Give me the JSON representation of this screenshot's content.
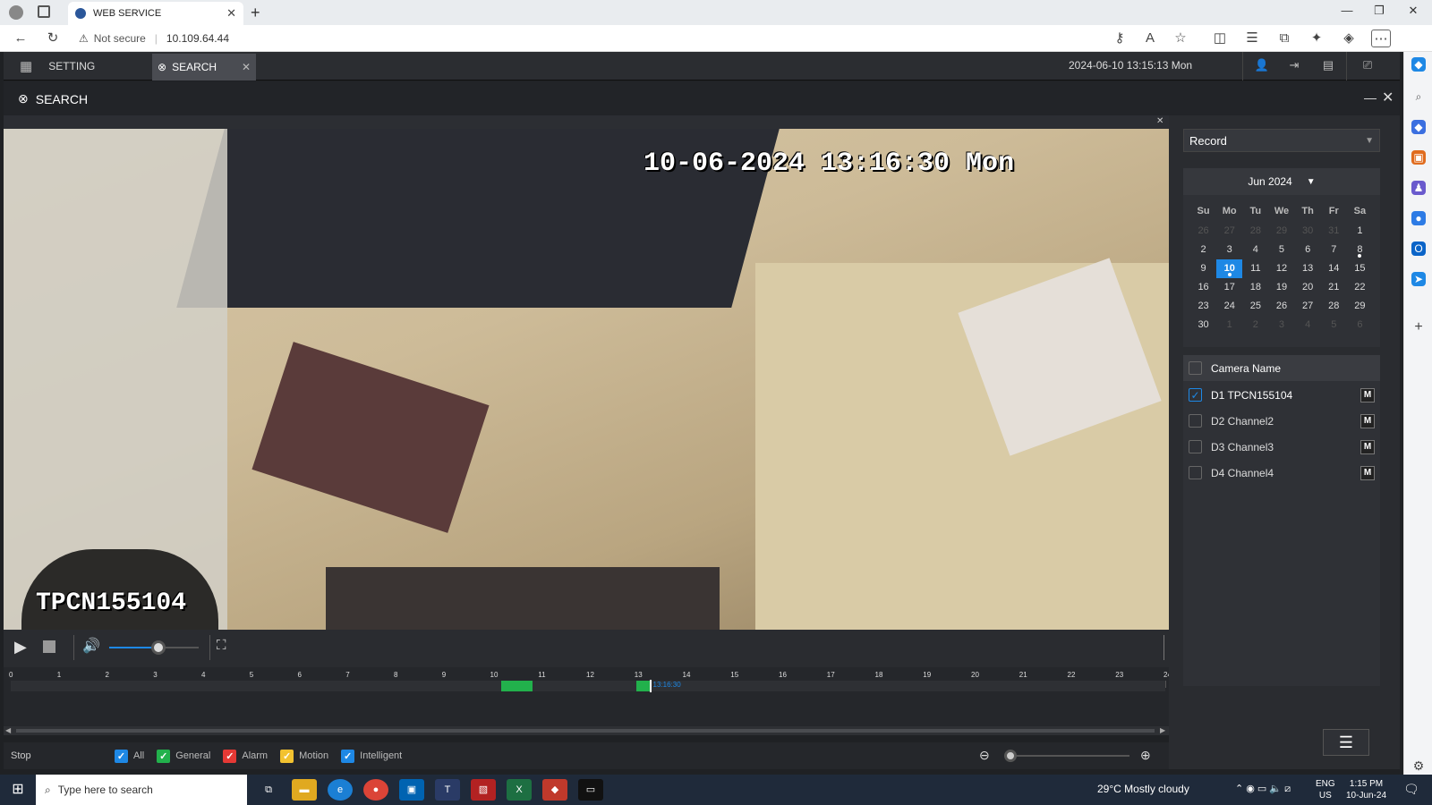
{
  "browser": {
    "tab_title": "WEB SERVICE",
    "security": "Not secure",
    "url": "10.109.64.44"
  },
  "app": {
    "setting_tab": "SETTING",
    "search_tab": "SEARCH",
    "datetime": "2024-06-10 13:15:13 Mon",
    "panel_title": "SEARCH"
  },
  "video": {
    "osd_time": "10-06-2024 13:16:30 Mon",
    "osd_camera": "TPCN155104"
  },
  "controls": {
    "volume_level": 0.55
  },
  "timeline": {
    "hours": [
      "0",
      "1",
      "2",
      "3",
      "4",
      "5",
      "6",
      "7",
      "8",
      "9",
      "10",
      "11",
      "12",
      "13",
      "14",
      "15",
      "16",
      "17",
      "18",
      "19",
      "20",
      "21",
      "22",
      "23",
      "24"
    ],
    "segments": [
      {
        "start": 10.2,
        "end": 10.85,
        "type": "General"
      },
      {
        "start": 13.0,
        "end": 13.3,
        "type": "General"
      }
    ],
    "cursor_label": "13:16:30"
  },
  "bottom": {
    "status": "Stop",
    "legend": [
      {
        "label": "All",
        "color": "#1e88e5"
      },
      {
        "label": "General",
        "color": "#22b14c"
      },
      {
        "label": "Alarm",
        "color": "#e53935"
      },
      {
        "label": "Motion",
        "color": "#f2c230"
      },
      {
        "label": "Intelligent",
        "color": "#1e88e5"
      }
    ]
  },
  "right": {
    "record_type": "Record",
    "calendar": {
      "month_label": "Jun 2024",
      "weekdays": [
        "Su",
        "Mo",
        "Tu",
        "We",
        "Th",
        "Fr",
        "Sa"
      ],
      "days": [
        [
          "26",
          "27",
          "28",
          "29",
          "30",
          "31",
          "1"
        ],
        [
          "2",
          "3",
          "4",
          "5",
          "6",
          "7",
          "8"
        ],
        [
          "9",
          "10",
          "11",
          "12",
          "13",
          "14",
          "15"
        ],
        [
          "16",
          "17",
          "18",
          "19",
          "20",
          "21",
          "22"
        ],
        [
          "23",
          "24",
          "25",
          "26",
          "27",
          "28",
          "29"
        ],
        [
          "30",
          "1",
          "2",
          "3",
          "4",
          "5",
          "6"
        ]
      ]
    },
    "camera_header": "Camera Name",
    "cameras": [
      {
        "label": "D1 TPCN155104",
        "checked": true,
        "m": "M"
      },
      {
        "label": "D2 Channel2",
        "checked": false,
        "m": "M"
      },
      {
        "label": "D3 Channel3",
        "checked": false,
        "m": "M"
      },
      {
        "label": "D4 Channel4",
        "checked": false,
        "m": "M"
      }
    ]
  },
  "taskbar": {
    "search_placeholder": "Type here to search",
    "weather": "29°C  Mostly cloudy",
    "lang": "ENG",
    "region": "US",
    "time": "1:15 PM",
    "date": "10-Jun-24"
  }
}
